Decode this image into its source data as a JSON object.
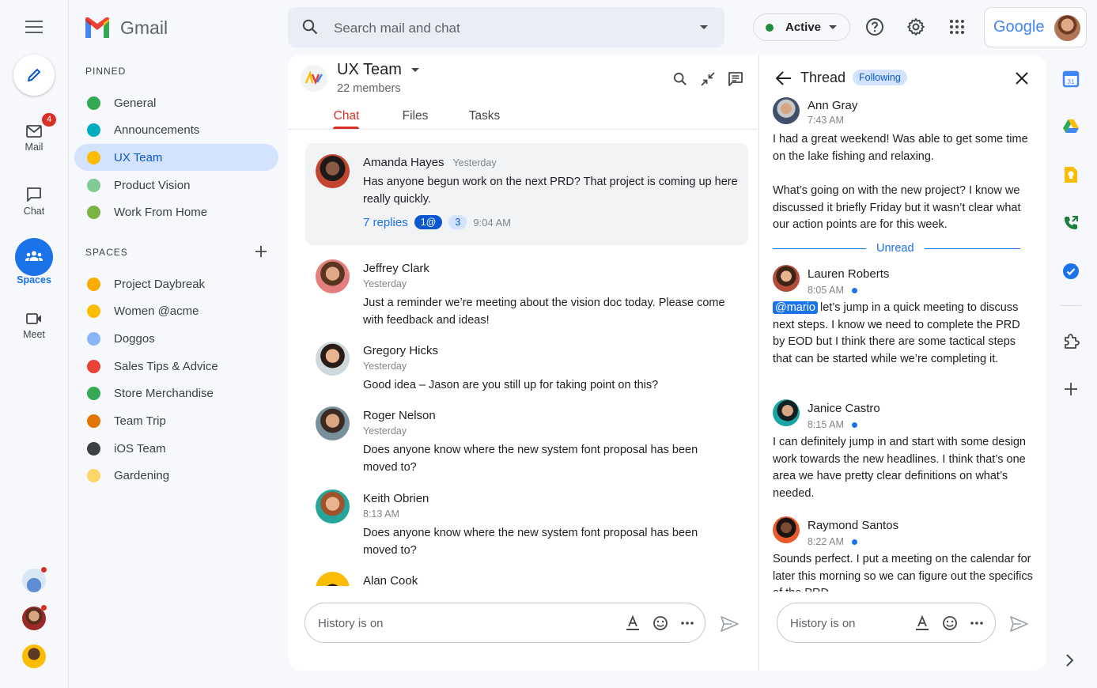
{
  "header": {
    "app_name": "Gmail",
    "search_placeholder": "Search mail and chat",
    "status_label": "Active",
    "google_label": "Google"
  },
  "rail": {
    "compose_icon": "pencil-icon",
    "mail_label": "Mail",
    "mail_badge": "4",
    "chat_label": "Chat",
    "spaces_label": "Spaces",
    "meet_label": "Meet"
  },
  "nav": {
    "pinned_header": "PINNED",
    "pinned": [
      {
        "label": "General",
        "color": "#34a853"
      },
      {
        "label": "Announcements",
        "color": "#00acc1"
      },
      {
        "label": "UX Team",
        "color": "#fbbc04"
      },
      {
        "label": "Product Vision",
        "color": "#81c995"
      },
      {
        "label": "Work From Home",
        "color": "#7cb342"
      }
    ],
    "spaces_header": "SPACES",
    "spaces": [
      {
        "label": "Project Daybreak",
        "color": "#f9ab00"
      },
      {
        "label": "Women @acme",
        "color": "#fbbc04"
      },
      {
        "label": "Doggos",
        "color": "#8ab4f8"
      },
      {
        "label": "Sales Tips & Advice",
        "color": "#ea4335"
      },
      {
        "label": "Store Merchandise",
        "color": "#34a853"
      },
      {
        "label": "Team Trip",
        "color": "#e37400"
      },
      {
        "label": "iOS Team",
        "color": "#3c4043"
      },
      {
        "label": "Gardening",
        "color": "#fdd663"
      }
    ]
  },
  "chat": {
    "title": "UX Team",
    "members": "22 members",
    "tabs": [
      "Chat",
      "Files",
      "Tasks"
    ],
    "pinned_message": {
      "name": "Amanda Hayes",
      "time": "Yesterday",
      "body": "Has anyone begun work on the next PRD? That project is coming up here really quickly.",
      "replies": "7 replies",
      "mention_badge": "1@",
      "count_badge": "3",
      "last_reply": "9:04 AM"
    },
    "messages": [
      {
        "name": "Jeffrey Clark",
        "time": "Yesterday",
        "body": "Just a reminder we’re meeting about the vision doc today. Please come with feedback and ideas!"
      },
      {
        "name": "Gregory Hicks",
        "time": "Yesterday",
        "body": "Good idea – Jason are you still up for taking point on this?"
      },
      {
        "name": "Roger Nelson",
        "time": "Yesterday",
        "body": "Does anyone know where the new system font proposal has been moved to?"
      },
      {
        "name": "Keith Obrien",
        "time": "8:13 AM",
        "body": "Does anyone know where the new system font proposal has been moved to?"
      },
      {
        "name": "Alan Cook",
        "time": "",
        "body": ""
      }
    ],
    "composer_placeholder": "History is on"
  },
  "thread": {
    "title": "Thread",
    "following": "Following",
    "unread_label": "Unread",
    "messages": [
      {
        "name": "Ann Gray",
        "time": "7:43 AM",
        "body1": "I had a great weekend! Was able to get some time on the lake fishing and relaxing.",
        "body2": "What’s going on with the new project? I know we discussed it briefly Friday but it wasn’t clear what our action points are for this week."
      },
      {
        "name": "Lauren Roberts",
        "time": "8:05 AM",
        "mention": "@mario",
        "body": "let’s jump in a quick meeting to discuss next steps. I know we need to complete the PRD by EOD but I think there are some tactical steps that can be started while we’re completing it."
      },
      {
        "name": "Janice Castro",
        "time": "8:15 AM",
        "body": "I can definitely jump in and start with some design work towards the new headlines. I think that’s one area we have pretty clear definitions on what’s needed."
      },
      {
        "name": "Raymond Santos",
        "time": "8:22 AM",
        "body": "Sounds perfect. I put a meeting on the calendar for later this morning so we can figure out the specifics of the PRD"
      }
    ],
    "composer_placeholder": "History is on"
  },
  "side_apps": [
    "calendar-icon",
    "drive-icon",
    "keep-icon",
    "voice-icon",
    "tasks-icon",
    "addons-icon",
    "add-icon"
  ],
  "colors": {
    "accent": "#1a73e8",
    "red": "#d93025",
    "selected_bg": "#d3e3fd"
  }
}
